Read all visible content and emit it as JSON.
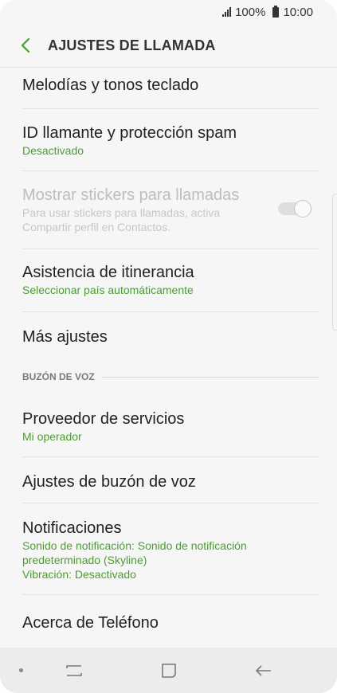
{
  "status_bar": {
    "battery": "100%",
    "time": "10:00",
    "icons": [
      "signal-icon",
      "battery-icon"
    ]
  },
  "header": {
    "back_icon": "chevron-left-icon",
    "title": "AJUSTES DE LLAMADA",
    "accent_color": "#4a9e2f"
  },
  "items": [
    {
      "title": "Melodías y tonos teclado"
    },
    {
      "title": "ID llamante y protección spam",
      "subtitle": "Desactivado"
    },
    {
      "title": "Mostrar stickers para llamadas",
      "subtitle": "Para usar stickers para llamadas, activa Compartir perfil en Contactos.",
      "disabled": true,
      "toggle": "off"
    },
    {
      "title": "Asistencia de itinerancia",
      "subtitle": "Seleccionar país automáticamente"
    },
    {
      "title": "Más ajustes"
    }
  ],
  "section": {
    "title": "BUZÓN DE VOZ",
    "items": [
      {
        "title": "Proveedor de servicios",
        "subtitle": "Mi operador"
      },
      {
        "title": "Ajustes de buzón de voz"
      },
      {
        "title": "Notificaciones",
        "subtitle": "Sonido de notificación: Sonido de notificación predeterminado (Skyline)",
        "subtitle2": "Vibración: Desactivado"
      },
      {
        "title": "Acerca de Teléfono"
      }
    ]
  },
  "nav_bar": {
    "icons": [
      "recent-apps-icon",
      "home-icon",
      "back-arrow-icon"
    ]
  }
}
